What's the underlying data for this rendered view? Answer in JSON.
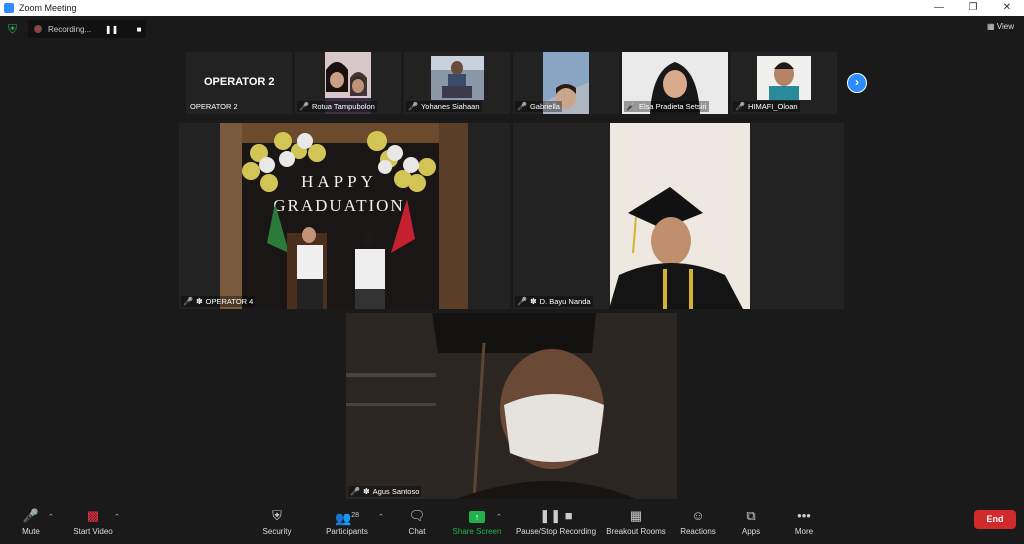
{
  "window": {
    "title": "Zoom Meeting"
  },
  "recording": {
    "label": "Recording..."
  },
  "view_label": "View",
  "strip": {
    "operator2_name": "OPERATOR 2",
    "operator2_label": "OPERATOR 2",
    "participants": [
      {
        "name": "Rotua Tampubolon"
      },
      {
        "name": "Yohanes Siahaan"
      },
      {
        "name": "Gabriella"
      },
      {
        "name": "Elsa Pradieta Setsiri"
      },
      {
        "name": "HIMAFI_Oloan"
      }
    ]
  },
  "main": {
    "banner_line1": "HAPPY",
    "banner_line2": "GRADUATION",
    "tiles": [
      {
        "name": "OPERATOR 4"
      },
      {
        "name": "D. Bayu Nanda"
      },
      {
        "name": "Agus Santoso"
      }
    ]
  },
  "toolbar": {
    "mute": "Mute",
    "start_video": "Start Video",
    "security": "Security",
    "participants": "Participants",
    "participants_count": "28",
    "chat": "Chat",
    "share_screen": "Share Screen",
    "recording": "Pause/Stop Recording",
    "breakout": "Breakout Rooms",
    "reactions": "Reactions",
    "apps": "Apps",
    "more": "More",
    "end": "End"
  }
}
